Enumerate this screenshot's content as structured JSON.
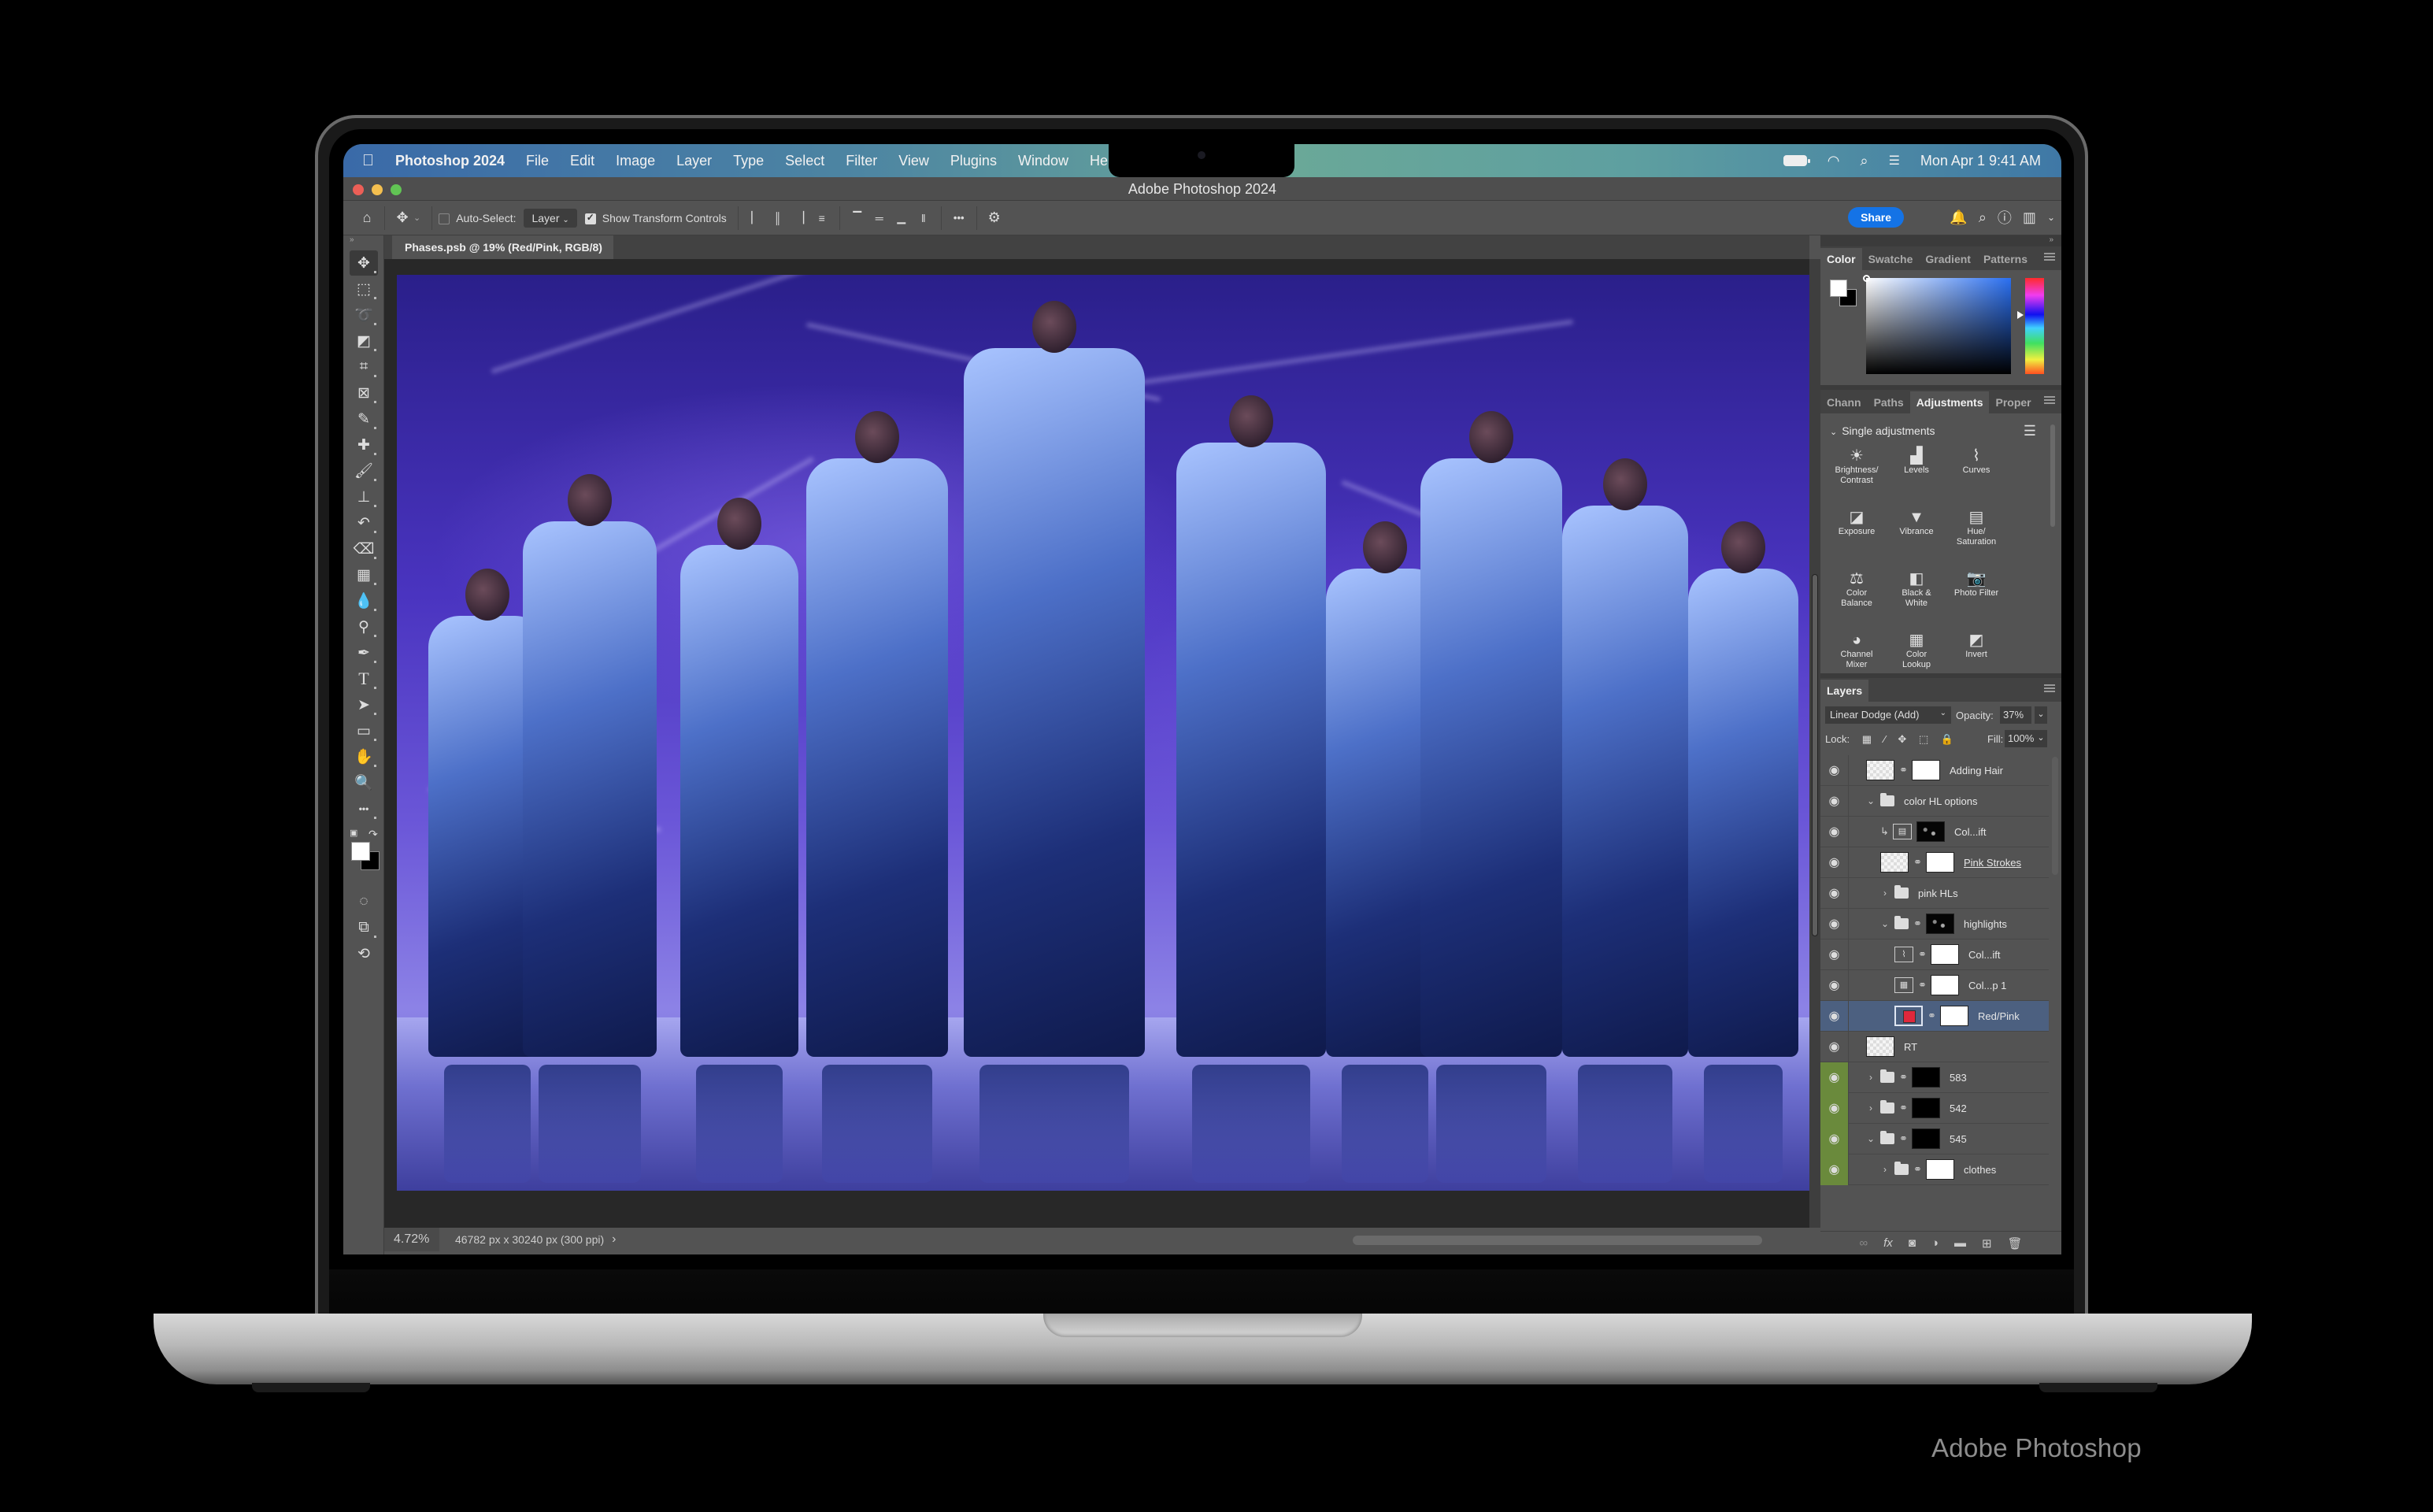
{
  "caption": "Adobe Photoshop",
  "menubar": {
    "app": "Photoshop 2024",
    "items": [
      "File",
      "Edit",
      "Image",
      "Layer",
      "Type",
      "Select",
      "Filter",
      "View",
      "Plugins",
      "Window",
      "Help"
    ],
    "status": {
      "datetime": "Mon Apr 1  9:41 AM",
      "icons": [
        "battery-icon",
        "wifi-icon",
        "spotlight-search-icon",
        "control-center-icon"
      ]
    }
  },
  "window": {
    "title": "Adobe Photoshop 2024",
    "traffic_lights": {
      "close": "#ec5f57",
      "minimize": "#f4bf4f",
      "zoom": "#61c454"
    }
  },
  "options_bar": {
    "auto_select_label": "Auto-Select:",
    "auto_select_checked": false,
    "auto_select_target": "Layer",
    "show_transform_label": "Show Transform Controls",
    "show_transform_checked": true,
    "more": "•••",
    "share_label": "Share",
    "share_color": "#1473e6"
  },
  "document": {
    "tab_label": "Phases.psb @ 19% (Red/Pink, RGB/8)",
    "zoom": "4.72%",
    "info": "46782 px x 30240 px (300 ppi)",
    "info_arrow": "›"
  },
  "tools": [
    {
      "name": "move-tool",
      "glyph": "✥"
    },
    {
      "name": "rectangular-marquee-tool",
      "glyph": "⬚"
    },
    {
      "name": "lasso-tool",
      "glyph": "➰"
    },
    {
      "name": "object-selection-tool",
      "glyph": "◩"
    },
    {
      "name": "crop-tool",
      "glyph": "⌗"
    },
    {
      "name": "frame-tool",
      "glyph": "⊠"
    },
    {
      "name": "eyedropper-tool",
      "glyph": "✎"
    },
    {
      "name": "spot-healing-brush-tool",
      "glyph": "✚"
    },
    {
      "name": "brush-tool",
      "glyph": "🖌"
    },
    {
      "name": "clone-stamp-tool",
      "glyph": "⊥"
    },
    {
      "name": "history-brush-tool",
      "glyph": "↶"
    },
    {
      "name": "eraser-tool",
      "glyph": "⌫"
    },
    {
      "name": "gradient-tool",
      "glyph": "▦"
    },
    {
      "name": "blur-tool",
      "glyph": "💧"
    },
    {
      "name": "dodge-tool",
      "glyph": "⚲"
    },
    {
      "name": "pen-tool",
      "glyph": "✒"
    },
    {
      "name": "type-tool",
      "glyph": "T"
    },
    {
      "name": "path-selection-tool",
      "glyph": "➤"
    },
    {
      "name": "rectangle-tool",
      "glyph": "▭"
    },
    {
      "name": "hand-tool",
      "glyph": "✋"
    },
    {
      "name": "zoom-tool",
      "glyph": "🔍"
    },
    {
      "name": "edit-toolbar",
      "glyph": "•••"
    }
  ],
  "color_panel": {
    "tabs": [
      "Color",
      "Swatche",
      "Gradient",
      "Patterns"
    ],
    "active_tab": "Color",
    "foreground": "#ffffff",
    "background": "#000000",
    "hue_color": "#2a6ff0"
  },
  "adjustments_panel": {
    "tabs": [
      "Chann",
      "Paths",
      "Adjustments",
      "Proper"
    ],
    "active_tab": "Adjustments",
    "section": "Single adjustments",
    "items": [
      {
        "label": "Brightness/\nContrast",
        "icon": "brightness-contrast-icon",
        "glyph": "☀"
      },
      {
        "label": "Levels",
        "icon": "levels-icon",
        "glyph": "▟"
      },
      {
        "label": "Curves",
        "icon": "curves-icon",
        "glyph": "⌇"
      },
      {
        "label": "Exposure",
        "icon": "exposure-icon",
        "glyph": "◪"
      },
      {
        "label": "Vibrance",
        "icon": "vibrance-icon",
        "glyph": "▼"
      },
      {
        "label": "Hue/\nSaturation",
        "icon": "hue-saturation-icon",
        "glyph": "▤"
      },
      {
        "label": "Color\nBalance",
        "icon": "color-balance-icon",
        "glyph": "⚖"
      },
      {
        "label": "Black &\nWhite",
        "icon": "black-white-icon",
        "glyph": "◧"
      },
      {
        "label": "Photo Filter",
        "icon": "photo-filter-icon",
        "glyph": "📷"
      },
      {
        "label": "Channel\nMixer",
        "icon": "channel-mixer-icon",
        "glyph": "◕"
      },
      {
        "label": "Color\nLookup",
        "icon": "color-lookup-icon",
        "glyph": "▦"
      },
      {
        "label": "Invert",
        "icon": "invert-icon",
        "glyph": "◩"
      }
    ]
  },
  "layers_panel": {
    "title": "Layers",
    "blend_mode": "Linear Dodge (Add)",
    "opacity_label": "Opacity:",
    "opacity": "37%",
    "lock_label": "Lock:",
    "fill_label": "Fill:",
    "fill": "100%",
    "layers": [
      {
        "name": "Adding Hair",
        "indent": 1,
        "type": "pixel",
        "thumb": "check",
        "mask": "white",
        "visible": true
      },
      {
        "name": "color HL options",
        "indent": 1,
        "type": "group",
        "expanded": true,
        "visible": true
      },
      {
        "name": "Col...ift",
        "indent": 2,
        "type": "adjustment",
        "clipped": true,
        "adj_glyph": "▤",
        "mask": "noise",
        "visible": true
      },
      {
        "name": "Pink Strokes",
        "indent": 2,
        "type": "pixel",
        "thumb": "check",
        "mask": "white",
        "underline": true,
        "visible": true
      },
      {
        "name": "pink HLs",
        "indent": 2,
        "type": "group",
        "expanded": false,
        "visible": true
      },
      {
        "name": "highlights",
        "indent": 2,
        "type": "group",
        "expanded": true,
        "mask": "noise",
        "visible": true
      },
      {
        "name": "Col...ift",
        "indent": 3,
        "type": "adjustment",
        "adj_glyph": "⌇",
        "mask": "white",
        "visible": true
      },
      {
        "name": "Col...p 1",
        "indent": 3,
        "type": "adjustment",
        "adj_glyph": "▦",
        "mask": "white",
        "visible": true
      },
      {
        "name": "Red/Pink",
        "indent": 3,
        "type": "fill",
        "thumb": "red",
        "mask": "white",
        "selected": true,
        "visible": true
      },
      {
        "name": "RT",
        "indent": 1,
        "type": "pixel",
        "thumb": "check",
        "visible": true
      },
      {
        "name": "583",
        "indent": 1,
        "type": "group",
        "expanded": false,
        "mask": "black",
        "visible": true,
        "color_label": "green"
      },
      {
        "name": "542",
        "indent": 1,
        "type": "group",
        "expanded": false,
        "mask": "black",
        "visible": true,
        "color_label": "green"
      },
      {
        "name": "545",
        "indent": 1,
        "type": "group",
        "expanded": true,
        "mask": "black",
        "visible": true,
        "color_label": "green"
      },
      {
        "name": "clothes",
        "indent": 2,
        "type": "group",
        "expanded": false,
        "mask": "white",
        "visible": true,
        "color_label": "green"
      }
    ],
    "footer_icons": [
      "link-layers-icon",
      "fx-icon",
      "add-mask-icon",
      "adjustment-layer-icon",
      "new-group-icon",
      "new-layer-icon",
      "delete-layer-icon"
    ]
  }
}
